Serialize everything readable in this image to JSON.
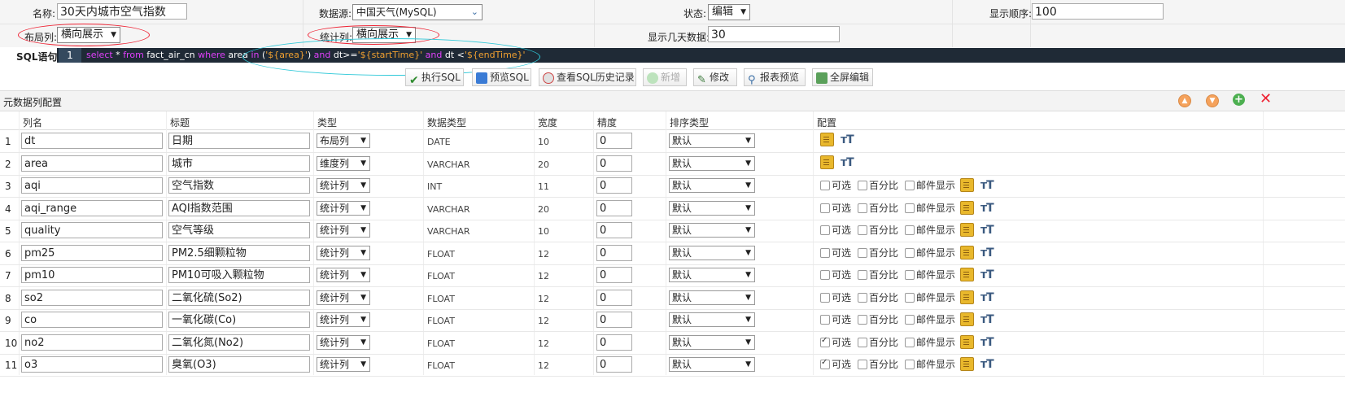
{
  "form": {
    "name_label": "名称:",
    "name_value": "30天内城市空气指数",
    "datasource_label": "数据源:",
    "datasource_value": "中国天气(MySQL)",
    "status_label": "状态:",
    "status_value": "编辑",
    "order_label": "显示顺序:",
    "order_value": "100",
    "layout_col_label": "布局列:",
    "layout_col_value": "横向展示",
    "stat_col_label": "统计列:",
    "stat_col_value": "横向展示",
    "days_label": "显示几天数据:",
    "days_value": "30",
    "sql_label": "SQL语句:"
  },
  "sql": {
    "line_no": "1",
    "kw_select": "select",
    "star": " * ",
    "kw_from": "from",
    "table": " fact_air_cn ",
    "kw_where": "where",
    "col_area": " area ",
    "kw_in": "in",
    "in_open": " (",
    "str_area": "'${area}'",
    "in_close": ") ",
    "kw_and1": "and",
    "dt_ge": " dt>=",
    "str_start": "'${startTime}'",
    "sp": " ",
    "kw_and2": "and",
    "dt_lt": " dt <",
    "str_end": "'${endTime}'"
  },
  "toolbar": {
    "exec_label": "执行SQL",
    "preview_sql_label": "预览SQL",
    "history_label": "查看SQL历史记录",
    "add_label": "新增",
    "edit_label": "修改",
    "report_preview_label": "报表预览",
    "fullscreen_label": "全屏编辑"
  },
  "section": {
    "title": "元数据列配置"
  },
  "grid": {
    "headers": {
      "name": "列名",
      "title": "标题",
      "type": "类型",
      "datatype": "数据类型",
      "width": "宽度",
      "precision": "精度",
      "sort": "排序类型",
      "config": "配置"
    },
    "cfg_labels": {
      "optional": "可选",
      "percent": "百分比",
      "mail": "邮件显示"
    },
    "rows": [
      {
        "idx": "1",
        "name": "dt",
        "title": "日期",
        "type": "布局列",
        "datatype": "DATE",
        "width": "10",
        "precision": "0",
        "sort": "默认",
        "stat": false,
        "optional": false
      },
      {
        "idx": "2",
        "name": "area",
        "title": "城市",
        "type": "维度列",
        "datatype": "VARCHAR",
        "width": "20",
        "precision": "0",
        "sort": "默认",
        "stat": false,
        "optional": false
      },
      {
        "idx": "3",
        "name": "aqi",
        "title": "空气指数",
        "type": "统计列",
        "datatype": "INT",
        "width": "11",
        "precision": "0",
        "sort": "默认",
        "stat": true,
        "optional": false
      },
      {
        "idx": "4",
        "name": "aqi_range",
        "title": "AQI指数范围",
        "type": "统计列",
        "datatype": "VARCHAR",
        "width": "20",
        "precision": "0",
        "sort": "默认",
        "stat": true,
        "optional": false
      },
      {
        "idx": "5",
        "name": "quality",
        "title": "空气等级",
        "type": "统计列",
        "datatype": "VARCHAR",
        "width": "10",
        "precision": "0",
        "sort": "默认",
        "stat": true,
        "optional": false
      },
      {
        "idx": "6",
        "name": "pm25",
        "title": "PM2.5细颗粒物",
        "type": "统计列",
        "datatype": "FLOAT",
        "width": "12",
        "precision": "0",
        "sort": "默认",
        "stat": true,
        "optional": false
      },
      {
        "idx": "7",
        "name": "pm10",
        "title": "PM10可吸入颗粒物",
        "type": "统计列",
        "datatype": "FLOAT",
        "width": "12",
        "precision": "0",
        "sort": "默认",
        "stat": true,
        "optional": false
      },
      {
        "idx": "8",
        "name": "so2",
        "title": "二氧化硫(So2)",
        "type": "统计列",
        "datatype": "FLOAT",
        "width": "12",
        "precision": "0",
        "sort": "默认",
        "stat": true,
        "optional": false
      },
      {
        "idx": "9",
        "name": "co",
        "title": "一氧化碳(Co)",
        "type": "统计列",
        "datatype": "FLOAT",
        "width": "12",
        "precision": "0",
        "sort": "默认",
        "stat": true,
        "optional": false
      },
      {
        "idx": "10",
        "name": "no2",
        "title": "二氧化氮(No2)",
        "type": "统计列",
        "datatype": "FLOAT",
        "width": "12",
        "precision": "0",
        "sort": "默认",
        "stat": true,
        "optional": true
      },
      {
        "idx": "11",
        "name": "o3",
        "title": "臭氧(O3)",
        "type": "统计列",
        "datatype": "FLOAT",
        "width": "12",
        "precision": "0",
        "sort": "默认",
        "stat": true,
        "optional": true
      }
    ]
  },
  "colors": {
    "sql_bg": "#1f2a36",
    "sql_keyword": "#e040fb",
    "sql_string": "#f0a030",
    "annotation_red": "#e23333",
    "annotation_cyan": "#2ec8d8"
  }
}
